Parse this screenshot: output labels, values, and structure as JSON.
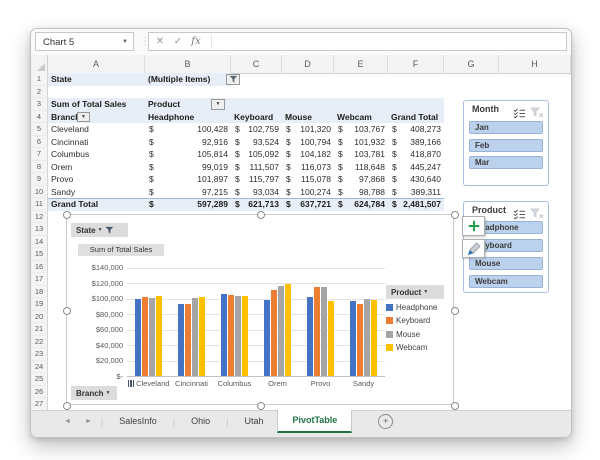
{
  "window": {
    "name_box": "Chart 5",
    "cancel_icon": "✕",
    "enter_icon": "✓",
    "fx_label": "fx",
    "dots": "⋮"
  },
  "grid": {
    "column_letters": [
      "A",
      "B",
      "C",
      "D",
      "E",
      "F",
      "G",
      "H"
    ],
    "row_numbers": [
      1,
      2,
      3,
      4,
      5,
      6,
      7,
      8,
      9,
      10,
      11,
      12,
      13,
      14,
      15,
      16,
      17,
      18,
      19,
      20,
      21,
      22,
      23,
      24,
      25,
      26,
      27
    ]
  },
  "filter_field": {
    "label": "State",
    "value": "(Multiple Items)"
  },
  "pivot": {
    "value_field_label": "Sum of Total Sales",
    "column_field": "Product",
    "row_field": "Branch",
    "currency_symbol": "$",
    "column_headers": [
      "Headphone",
      "Keyboard",
      "Mouse",
      "Webcam",
      "Grand Total"
    ],
    "data_rows": [
      {
        "branch": "Cleveland",
        "values": [
          "100,428",
          "102,759",
          "101,320",
          "103,767",
          "408,273"
        ]
      },
      {
        "branch": "Cincinnati",
        "values": [
          "92,916",
          "93,524",
          "100,794",
          "101,932",
          "389,166"
        ]
      },
      {
        "branch": "Columbus",
        "values": [
          "105,814",
          "105,092",
          "104,182",
          "103,781",
          "418,870"
        ]
      },
      {
        "branch": "Orem",
        "values": [
          "99,019",
          "111,507",
          "116,073",
          "118,648",
          "445,247"
        ]
      },
      {
        "branch": "Provo",
        "values": [
          "101,897",
          "115,797",
          "115,078",
          "97,868",
          "430,640"
        ]
      },
      {
        "branch": "Sandy",
        "values": [
          "97,215",
          "93,034",
          "100,274",
          "98,788",
          "389,311"
        ]
      }
    ],
    "grand_total_row": {
      "branch": "Grand Total",
      "values": [
        "597,289",
        "621,713",
        "637,721",
        "624,784",
        "2,481,507"
      ]
    }
  },
  "slicers": [
    {
      "title": "Month",
      "items": [
        {
          "label": "Jan",
          "selected": true
        },
        {
          "label": "Feb",
          "selected": true
        },
        {
          "label": "Mar",
          "selected": true
        }
      ]
    },
    {
      "title": "Product",
      "items": [
        {
          "label": "Headphone",
          "selected": true
        },
        {
          "label": "Keyboard",
          "selected": true
        },
        {
          "label": "Mouse",
          "selected": true
        },
        {
          "label": "Webcam",
          "selected": true
        }
      ]
    }
  ],
  "chart": {
    "title": "Sum of Total Sales",
    "field_buttons": {
      "state": "State",
      "branch": "Branch",
      "legend": "Product"
    }
  },
  "chart_data": {
    "type": "bar",
    "title": "Sum of Total Sales",
    "categories": [
      "Cleveland",
      "Cincinnati",
      "Columbus",
      "Orem",
      "Provo",
      "Sandy"
    ],
    "series": [
      {
        "name": "Headphone",
        "color": "#4472C4",
        "values": [
          100428,
          92916,
          105814,
          99019,
          101897,
          97215
        ]
      },
      {
        "name": "Keyboard",
        "color": "#ED7D31",
        "values": [
          102759,
          93524,
          105092,
          111507,
          115797,
          93034
        ]
      },
      {
        "name": "Mouse",
        "color": "#A5A5A5",
        "values": [
          101320,
          100794,
          104182,
          116073,
          115078,
          100274
        ]
      },
      {
        "name": "Webcam",
        "color": "#FFC000",
        "values": [
          103767,
          101932,
          103781,
          118648,
          97868,
          98788
        ]
      }
    ],
    "ylim": [
      0,
      140000
    ],
    "ytick_step": 20000,
    "ytick_labels": [
      "$-",
      "$20,000",
      "$40,000",
      "$60,000",
      "$80,000",
      "$100,000",
      "$120,000",
      "$140,000"
    ],
    "xlabel": "Branch",
    "ylabel": "",
    "legend_title": "Product",
    "legend_entries": [
      "Headphone",
      "Keyboard",
      "Mouse",
      "Webcam"
    ],
    "legend_position": "right",
    "grid": true
  },
  "sheet_tabs": {
    "tabs": [
      "SalesInfo",
      "Ohio",
      "Utah",
      "PivotTable"
    ],
    "active": "PivotTable"
  },
  "colors": {
    "pivot_header_bg": "#E8EEF7",
    "grand_total_border": "#9FB6D9",
    "slicer_button_bg": "#BCD2EC",
    "slicer_border": "#A9C0E0",
    "active_tab_green": "#217346",
    "series_headphone": "#4472C4",
    "series_keyboard": "#ED7D31",
    "series_mouse": "#A5A5A5",
    "series_webcam": "#FFC000"
  }
}
